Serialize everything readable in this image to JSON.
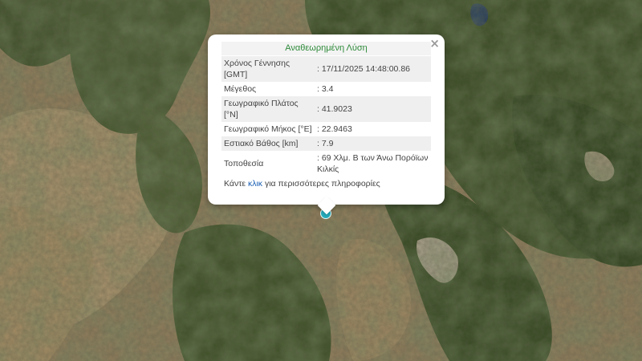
{
  "popup": {
    "title": "Αναθεωρημένη Λύση",
    "close_icon": "close-icon",
    "rows": [
      {
        "label": "Χρόνος Γέννησης [GMT]",
        "value": ": 17/11/2025 14:48:00.86"
      },
      {
        "label": "Μέγεθος",
        "value": ": 3.4"
      },
      {
        "label": "Γεωγραφικό Πλάτος [°N]",
        "value": ": 41.9023"
      },
      {
        "label": "Γεωγραφικό Μήκος [°E]",
        "value": ": 22.9463"
      },
      {
        "label": "Εστιακό Βάθος [km]",
        "value": ": 7.9"
      },
      {
        "label": "Τοποθεσία",
        "value": ": 69 Χλμ. Β των Άνω Πορόϊων Κιλκίς"
      }
    ],
    "more_prefix": "Κάντε ",
    "more_link": "κλικ",
    "more_suffix": " για περισσότερες πληροφορίες"
  },
  "colors": {
    "title_text": "#2e8b3a",
    "marker": "#27b1c2",
    "link": "#1a5fb4"
  },
  "map": {
    "type": "satellite",
    "marker_icon": "earthquake-epicenter-marker"
  }
}
